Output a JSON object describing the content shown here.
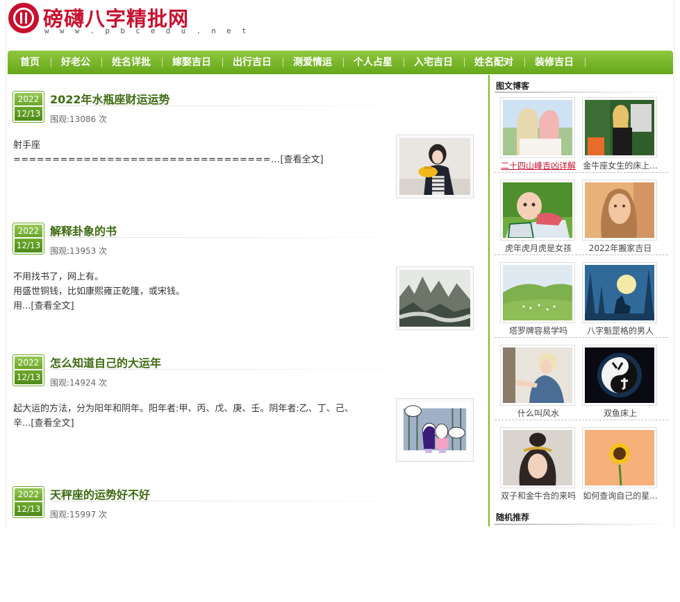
{
  "header": {
    "site_title": "磅礴八字精批网",
    "site_url": "w w w . p b c e d u . n e t"
  },
  "nav": [
    "首页",
    "好老公",
    "姓名详批",
    "嫁娶吉日",
    "出行吉日",
    "测爱情运",
    "个人占星",
    "入宅吉日",
    "姓名配对",
    "装修吉日"
  ],
  "posts": [
    {
      "year": "2022",
      "day": "12/13",
      "title": "2022年水瓶座财运运势",
      "views": "围观:13086 次",
      "excerpt_lines": [
        "射手座",
        "=================================..."
      ],
      "readmore": "[查看全文]"
    },
    {
      "year": "2022",
      "day": "12/13",
      "title": "解释卦象的书",
      "views": "围观:13953 次",
      "excerpt_lines": [
        "不用找书了，网上有。",
        "用盛世铜钱，比如康熙雍正乾隆，或宋钱。",
        "用..."
      ],
      "readmore": "[查看全文]"
    },
    {
      "year": "2022",
      "day": "12/13",
      "title": "怎么知道自己的大运年",
      "views": "围观:14924 次",
      "excerpt_lines": [
        "起大运的方法，分为阳年和阴年。阳年者:甲、丙、戊、庚、壬。阴年者:乙、丁、己、",
        "辛..."
      ],
      "readmore": "[查看全文]"
    },
    {
      "year": "2022",
      "day": "12/13",
      "title": "天秤座的运势好不好",
      "views": "围观:15997 次"
    }
  ],
  "sidebar": {
    "section_title": "图文博客",
    "random_title": "随机推荐",
    "cards": [
      {
        "caption": "二十四山峰吉凶详解",
        "highlight": true
      },
      {
        "caption": "金牛座女生的床上..."
      },
      {
        "caption": "虎年虎月虎是女孩"
      },
      {
        "caption": "2022年搬家吉日"
      },
      {
        "caption": "塔罗牌容易学吗"
      },
      {
        "caption": "八字魁罡格的男人"
      },
      {
        "caption": "什么叫风水"
      },
      {
        "caption": "双鱼床上"
      },
      {
        "caption": "双子和金牛合的来吗"
      },
      {
        "caption": "如何查询自己的星..."
      }
    ]
  }
}
